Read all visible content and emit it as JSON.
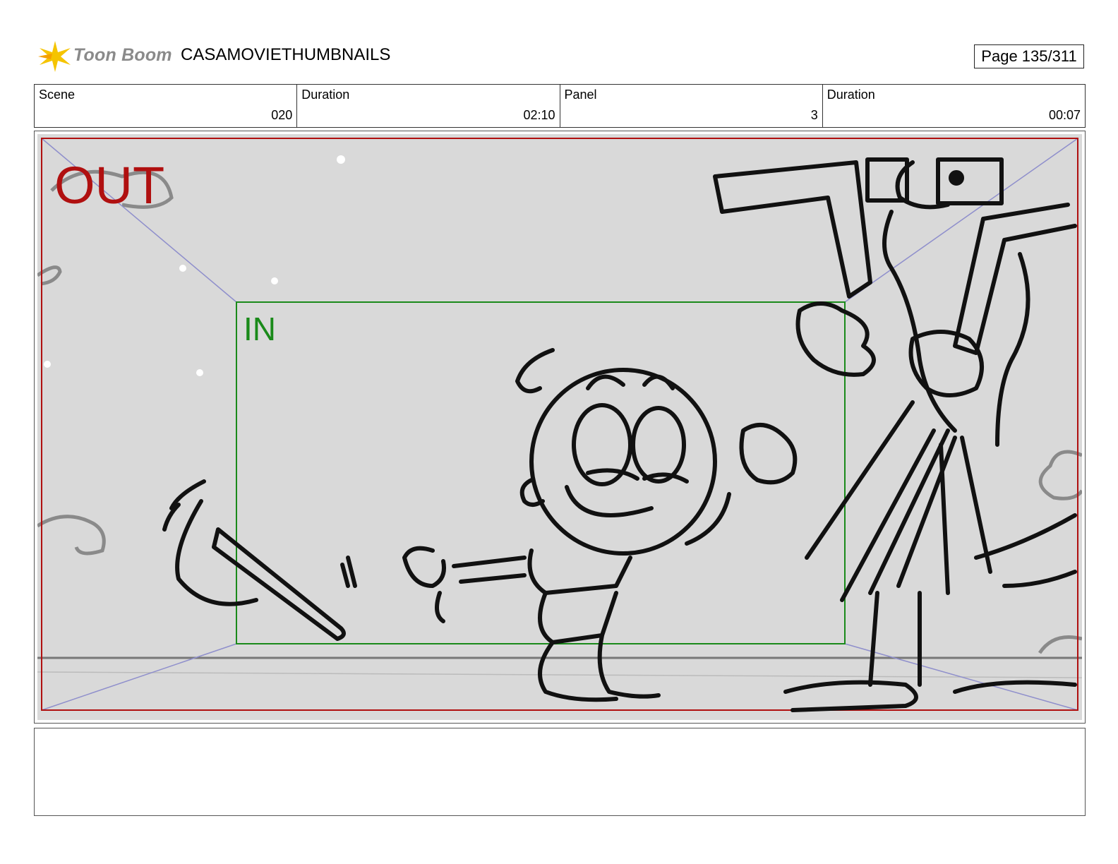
{
  "header": {
    "logo_text": "Toon Boom",
    "project_title": "CASAMOVIETHUMBNAILS",
    "page_label": "Page 135/311"
  },
  "info": [
    {
      "label": "Scene",
      "value": "020"
    },
    {
      "label": "Duration",
      "value": "02:10"
    },
    {
      "label": "Panel",
      "value": "3"
    },
    {
      "label": "Duration",
      "value": "00:07"
    }
  ],
  "panel": {
    "out_label": "OUT",
    "in_label": "IN",
    "out_color": "#b01010",
    "in_color": "#1a8a1a",
    "background_color": "#d9d9d9"
  },
  "notes": {
    "text": ""
  },
  "colors": {
    "logo_star": "#f5c400",
    "logo_text": "#8a8a8a"
  }
}
